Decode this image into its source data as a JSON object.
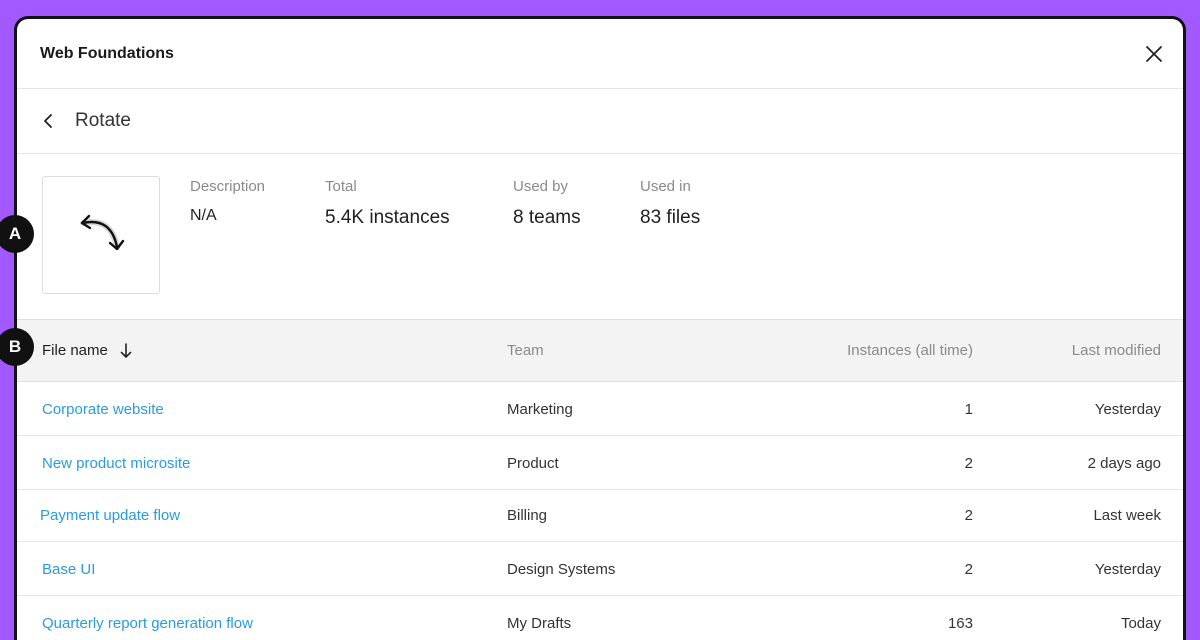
{
  "header": {
    "title": "Web Foundations"
  },
  "subheader": {
    "title": "Rotate"
  },
  "info": {
    "description": {
      "label": "Description",
      "value": "N/A"
    },
    "total": {
      "label": "Total",
      "value": "5.4K instances"
    },
    "used_by": {
      "label": "Used by",
      "value": "8 teams"
    },
    "used_in": {
      "label": "Used in",
      "value": "83 files"
    },
    "thumbnail_icon": "rotate-arrow-icon"
  },
  "table": {
    "columns": [
      "File name",
      "Team",
      "Instances (all time)",
      "Last modified"
    ],
    "sort_icon": "arrow-down-icon",
    "rows": [
      {
        "file": "Corporate website",
        "team": "Marketing",
        "instances": "1",
        "modified": "Yesterday"
      },
      {
        "file": "New product microsite",
        "team": "Product",
        "instances": "2",
        "modified": "2 days ago"
      },
      {
        "file": "Payment update flow",
        "team": "Billing",
        "instances": "2",
        "modified": "Last week"
      },
      {
        "file": "Base UI",
        "team": "Design Systems",
        "instances": "2",
        "modified": "Yesterday"
      },
      {
        "file": "Quarterly report generation flow",
        "team": "My Drafts",
        "instances": "163",
        "modified": "Today"
      }
    ]
  },
  "markers": {
    "a": "A",
    "b": "B"
  },
  "colors": {
    "background": "#a259ff",
    "link": "#2a9be0",
    "marker": "#111111"
  }
}
